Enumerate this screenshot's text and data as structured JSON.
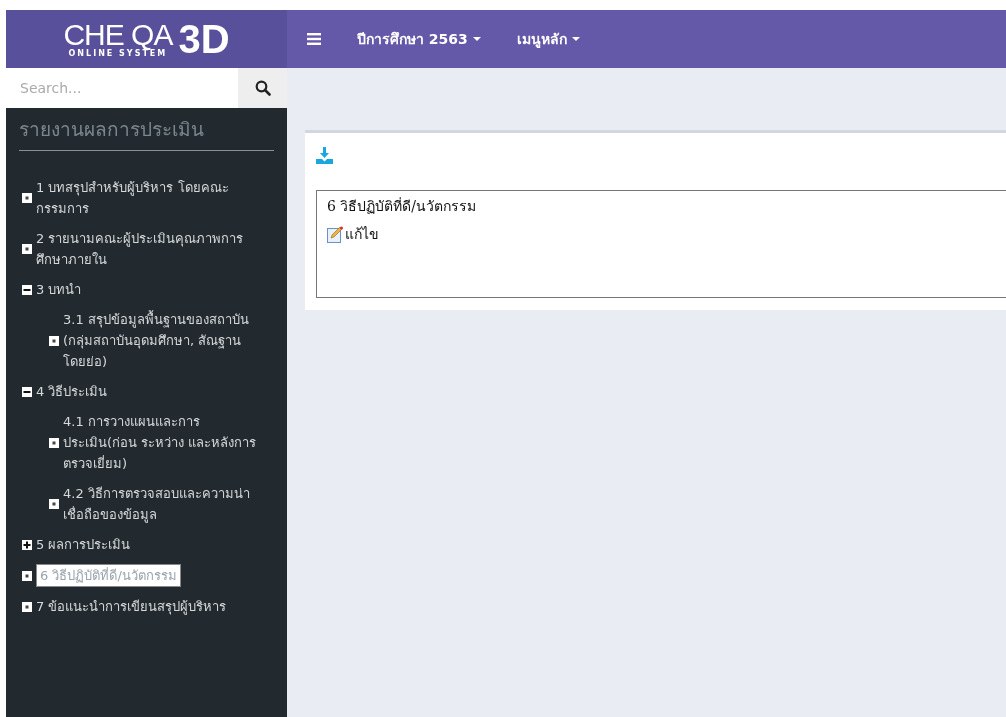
{
  "logo": {
    "title": "CHE QA",
    "mark": "3D",
    "subtitle": "ONLINE SYSTEM"
  },
  "topbar": {
    "menus": [
      {
        "label": "ปีการศึกษา 2563"
      },
      {
        "label": "เมนูหลัก"
      }
    ]
  },
  "search": {
    "placeholder": "Search..."
  },
  "sidebar": {
    "heading": "รายงานผลการประเมิน",
    "tree": [
      {
        "label": "1 บทสรุปสำหรับผู้บริหาร โดยคณะกรรมการ",
        "kind": "leaf",
        "selected": false
      },
      {
        "label": "2 รายนามคณะผู้ประเมินคุณภาพการศึกษาภายใน",
        "kind": "leaf",
        "selected": false
      },
      {
        "label": "3 บทนำ",
        "kind": "folder",
        "expanded": true,
        "selected": false,
        "children": [
          {
            "label": "3.1 สรุปข้อมูลพื้นฐานของสถาบัน (กลุ่มสถาบันอุดมศึกษา, สัณฐานโดยย่อ)",
            "kind": "leaf",
            "selected": false
          }
        ]
      },
      {
        "label": "4 วิธีประเมิน",
        "kind": "folder",
        "expanded": true,
        "selected": false,
        "children": [
          {
            "label": "4.1 การวางแผนและการประเมิน(ก่อน ระหว่าง และหลังการตรวจเยี่ยม)",
            "kind": "leaf",
            "selected": false
          },
          {
            "label": "4.2 วิธีการตรวจสอบและความน่าเชื่อถือของข้อมูล",
            "kind": "leaf",
            "selected": false
          }
        ]
      },
      {
        "label": "5 ผลการประเมิน",
        "kind": "folder",
        "expanded": false,
        "selected": false
      },
      {
        "label": "6 วิธีปฏิบัติที่ดี/นวัตกรรม",
        "kind": "leaf",
        "selected": true
      },
      {
        "label": "7 ข้อแนะนำการเขียนสรุปผู้บริหาร",
        "kind": "leaf",
        "selected": false
      }
    ]
  },
  "content": {
    "title": "6 วิธีปฏิบัติที่ดี/นวัตกรรม",
    "edit_link": "แก้ไข"
  }
}
